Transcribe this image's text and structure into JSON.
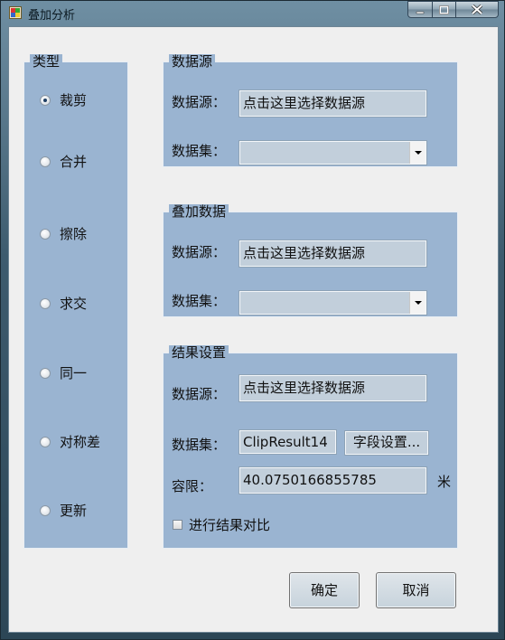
{
  "window": {
    "title": "叠加分析",
    "minimize_symbol": "▁",
    "maximize_symbol": "□",
    "close_symbol": "✕"
  },
  "type_group": {
    "label": "类型",
    "options": [
      {
        "label": "裁剪",
        "selected": true
      },
      {
        "label": "合并",
        "selected": false
      },
      {
        "label": "擦除",
        "selected": false
      },
      {
        "label": "求交",
        "selected": false
      },
      {
        "label": "同一",
        "selected": false
      },
      {
        "label": "对称差",
        "selected": false
      },
      {
        "label": "更新",
        "selected": false
      }
    ]
  },
  "source_group": {
    "label": "数据源",
    "datasource_label": "数据源：",
    "datasource_value": "点击这里选择数据源",
    "dataset_label": "数据集：",
    "dataset_value": ""
  },
  "overlay_group": {
    "label": "叠加数据",
    "datasource_label": "数据源：",
    "datasource_value": "点击这里选择数据源",
    "dataset_label": "数据集：",
    "dataset_value": ""
  },
  "result_group": {
    "label": "结果设置",
    "datasource_label": "数据源：",
    "datasource_value": "点击这里选择数据源",
    "dataset_label": "数据集：",
    "dataset_value": "ClipResult14",
    "field_settings_label": "字段设置...",
    "tolerance_label": "容限：",
    "tolerance_value": "40.0750166855785",
    "tolerance_unit": "米",
    "compare_label": "进行结果对比",
    "compare_checked": false
  },
  "buttons": {
    "ok": "确定",
    "cancel": "取消"
  },
  "colors": {
    "group_bg": "#9ab4d1",
    "field_bg": "#c2cfdb",
    "client_bg": "#efefef"
  }
}
